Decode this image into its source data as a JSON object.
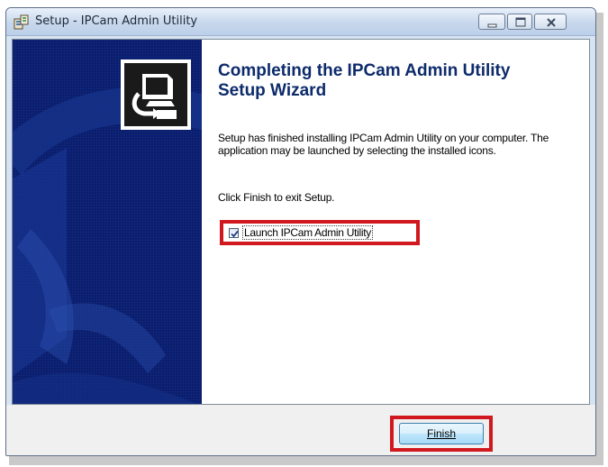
{
  "window": {
    "title": "Setup - IPCam Admin Utility",
    "icon": "installer-icon",
    "controls": [
      "minimize-icon",
      "maximize-icon",
      "close-icon"
    ]
  },
  "wizard": {
    "heading": "Completing the IPCam Admin Utility Setup Wizard",
    "body": "Setup has finished installing IPCam Admin Utility on your computer. The application may be launched by selecting the installed icons.",
    "instruction": "Click Finish to exit Setup.",
    "launch_checkbox": {
      "label": "Launch IPCam Admin Utility",
      "checked": true
    },
    "logo_icon": "computer-install-icon"
  },
  "footer": {
    "finish_label": "Finish"
  },
  "colors": {
    "side_panel": "#0c1f6e",
    "heading": "#0d2b6b",
    "highlight": "#d0181e"
  }
}
